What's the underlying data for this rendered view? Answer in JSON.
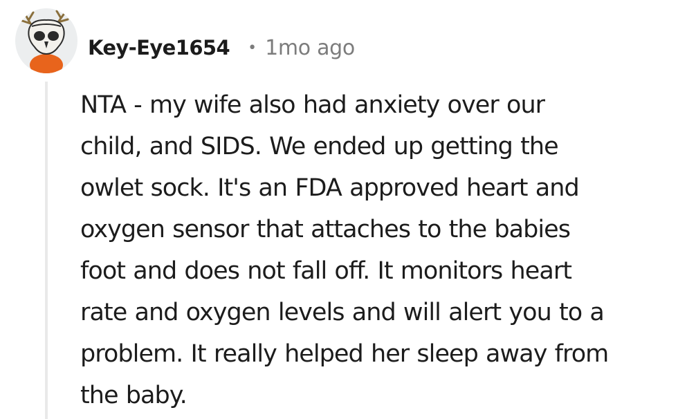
{
  "comment": {
    "author": "Key-Eye1654",
    "separator": "•",
    "timestamp": "1mo ago",
    "avatar": {
      "icon": "owl-skull-avatar-icon",
      "colors": {
        "background": "#eceeef",
        "body": "#e8641c",
        "skull": "#f3f1ec",
        "antlers": "#8a6f3c"
      }
    },
    "lines": [
      "NTA - my wife also had anxiety over our",
      "child, and SIDS. We ended up getting the",
      "owlet sock. It's an FDA approved heart and",
      "oxygen sensor that attaches to the babies",
      "foot and does not fall off. It monitors heart",
      "rate and oxygen levels and will alert you to a",
      "problem. It really helped her sleep away from",
      "the baby."
    ]
  },
  "colors": {
    "text": "#1c1c1c",
    "meta": "#7c7c7c",
    "thread_line": "#e9e9e9"
  }
}
